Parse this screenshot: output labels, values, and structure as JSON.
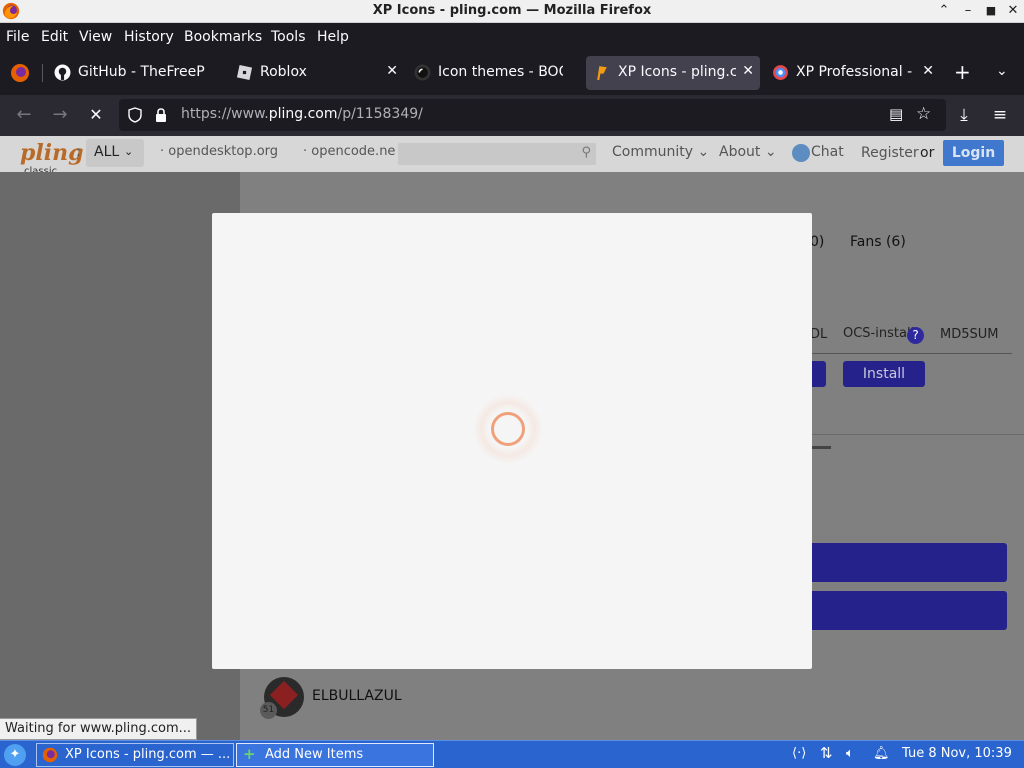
{
  "window": {
    "title": "XP Icons - pling.com — Mozilla Firefox"
  },
  "menubar": [
    "File",
    "Edit",
    "View",
    "History",
    "Bookmarks",
    "Tools",
    "Help"
  ],
  "tabs": [
    {
      "label": "GitHub - TheFreeP",
      "icon": "github-icon"
    },
    {
      "label": "Roblox",
      "icon": "roblox-icon"
    },
    {
      "label": "Icon themes - BOO",
      "icon": "icon-themes-icon"
    },
    {
      "label": "XP Icons - pling.co",
      "icon": "pling-icon",
      "active": true
    },
    {
      "label": "XP Professional - C",
      "icon": "xp-icon"
    }
  ],
  "navbar": {
    "url_prefix": "https://www.",
    "url_host": "pling.com",
    "url_path": "/p/1158349/"
  },
  "site": {
    "logo": "pling",
    "logo_sub": "classic",
    "all_label": "ALL",
    "link1": "opendesktop.org",
    "link2": "opencode.ne",
    "community": "Community",
    "about": "About",
    "chat": "Chat",
    "register": "Register",
    "or": "or",
    "login": "Login"
  },
  "content": {
    "tab_partial": "0)",
    "fans": "Fans (6)",
    "col_dl": "DL",
    "col_ocs": "OCS-install",
    "col_md5": "MD5SUM",
    "install": "Install",
    "user": "ELBULLAZUL",
    "user_badge": "51"
  },
  "status": "Waiting for www.pling.com...",
  "taskbar": {
    "task1": "XP Icons - pling.com — ...",
    "task2": "Add New Items",
    "clock": "Tue  8 Nov, 10:39"
  },
  "colors": {
    "accent": "#4c46d6",
    "login": "#3f78cc",
    "taskbar": "#2a64cf",
    "spinner": "#f0a07a"
  }
}
